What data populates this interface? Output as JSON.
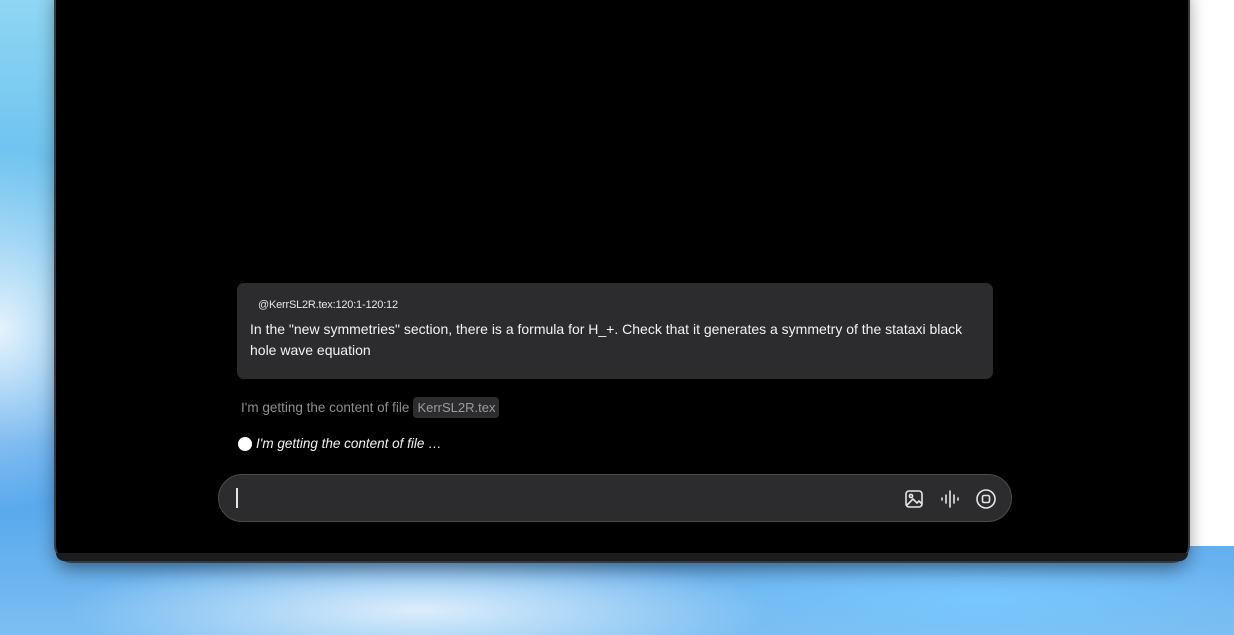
{
  "conversation": {
    "user_message": {
      "file_reference": "@KerrSL2R.tex:120:1-120:12",
      "text": "In the \"new symmetries\" section, there is a formula for H_+. Check that it generates a symmetry of the stataxi black hole wave equation"
    },
    "status": {
      "prefix": "I'm getting the content of file",
      "file_chip": "KerrSL2R.tex"
    },
    "progress": {
      "text": "I'm getting the content of file …"
    }
  },
  "input_bar": {
    "value": "",
    "icons": {
      "image": "image-icon",
      "voice": "voice-waveform-icon",
      "stop": "stop-icon"
    }
  },
  "colors": {
    "window_bg": "#000000",
    "bubble_bg": "#2c2c2e",
    "text_primary": "#f2f2f7",
    "text_muted": "#8e8e93"
  }
}
